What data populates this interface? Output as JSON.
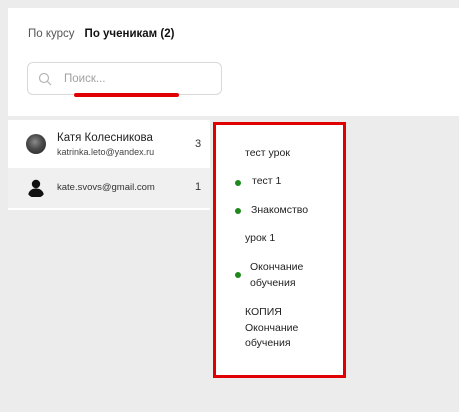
{
  "tabs": [
    {
      "label": "По курсу",
      "active": false
    },
    {
      "label": "По ученикам (2)",
      "active": true
    }
  ],
  "search": {
    "placeholder": "Поиск...",
    "value": ""
  },
  "students": [
    {
      "name": "Катя Колесникова",
      "email": "katrinka.leto@yandex.ru",
      "count": "3",
      "avatar": "photo-avatar"
    },
    {
      "name": "",
      "email": "kate.svovs@gmail.com",
      "count": "1",
      "avatar": "default-user-icon",
      "selected": true
    }
  ],
  "lessons": [
    {
      "title": "тест урок",
      "dot": false
    },
    {
      "title": "тест 1",
      "dot": true
    },
    {
      "title": "Знакомство",
      "dot": true
    },
    {
      "title": "урок 1",
      "dot": false
    },
    {
      "title_line1": "Окончание",
      "title_line2": "обучения",
      "dot": true
    },
    {
      "title_line1": "КОПИЯ",
      "title_line2": "Окончание",
      "title_line3": "обучения",
      "dot": false
    }
  ],
  "colors": {
    "accent_red": "#e00000",
    "status_green": "#1e8a1e",
    "background": "#ececec"
  }
}
